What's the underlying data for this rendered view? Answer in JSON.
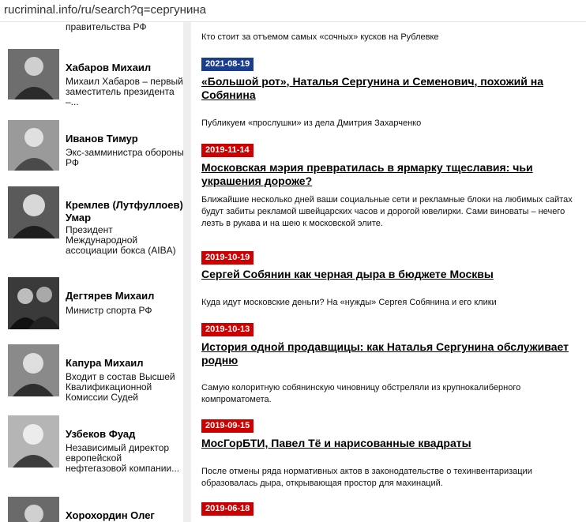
{
  "browser": {
    "url": "rucriminal.info/ru/search?q=сергунина"
  },
  "sidebar": {
    "prev_desc_tail": "правительства РФ",
    "people": [
      {
        "name": "Хабаров Михаил",
        "desc": "Михаил Хабаров – первый заместитель президента –..."
      },
      {
        "name": "Иванов Тимур",
        "desc": "Экс-замминистра обороны РФ"
      },
      {
        "name": "Кремлев (Лутфуллоев) Умар",
        "desc": "Президент Международной ассоциации бокса (AIBA)"
      },
      {
        "name": "Дегтярев Михаил",
        "desc": "Министр спорта РФ"
      },
      {
        "name": "Капура Михаил",
        "desc": "Входит в состав Высшей Квалификационной Комиссии Судей"
      },
      {
        "name": "Узбеков Фуад",
        "desc": "Независимый директор европейской нефтегазовой компании..."
      },
      {
        "name": "Хорохордин Олег",
        "desc": ""
      }
    ]
  },
  "results": {
    "top_lead": "Кто стоит за отъемом самых «сочных» кусков на Рублевке",
    "items": [
      {
        "date": "2021-08-19",
        "title": "«Большой рот», Наталья Сергунина и Семенович, похожий на Собянина",
        "lead": "Публикуем «прослушки» из дела Дмитрия Захарченко"
      },
      {
        "date": "2019-11-14",
        "title": "Московская мэрия превратилась в ярмарку тщеславия: чьи украшения дороже?",
        "lead": "Ближайшие несколько дней ваши социальные сети и рекламные блоки на любимых сайтах будут забиты рекламой швейцарских часов и дорогой ювелирки. Сами виноваты – нечего лезть в рукава и на шею к московской элите."
      },
      {
        "date": "2019-10-19",
        "title": "Сергей Собянин как черная дыра в бюджете Москвы",
        "lead": "Куда идут московские деньги? На «нужды» Сергея Собянина и его клики"
      },
      {
        "date": "2019-10-13",
        "title": "История одной продавщицы: как Наталья Сергунина обслуживает родню",
        "lead": "Самую колоритную собянинскую чиновницу обстреляли из крупнокалиберного компроматомета."
      },
      {
        "date": "2019-09-15",
        "title": "МосГорБТИ, Павел Тё и нарисованные квадраты",
        "lead": "После отмены ряда нормативных актов в законодательстве о техинвентаризации образовалась дыра, открывающая простор для махинаций."
      },
      {
        "date": "2019-06-18",
        "title": "",
        "lead": ""
      }
    ]
  },
  "colors": {
    "date_badge": "#cc0000",
    "selected_date": "#1a3e8c",
    "selection": "#3165c8"
  }
}
